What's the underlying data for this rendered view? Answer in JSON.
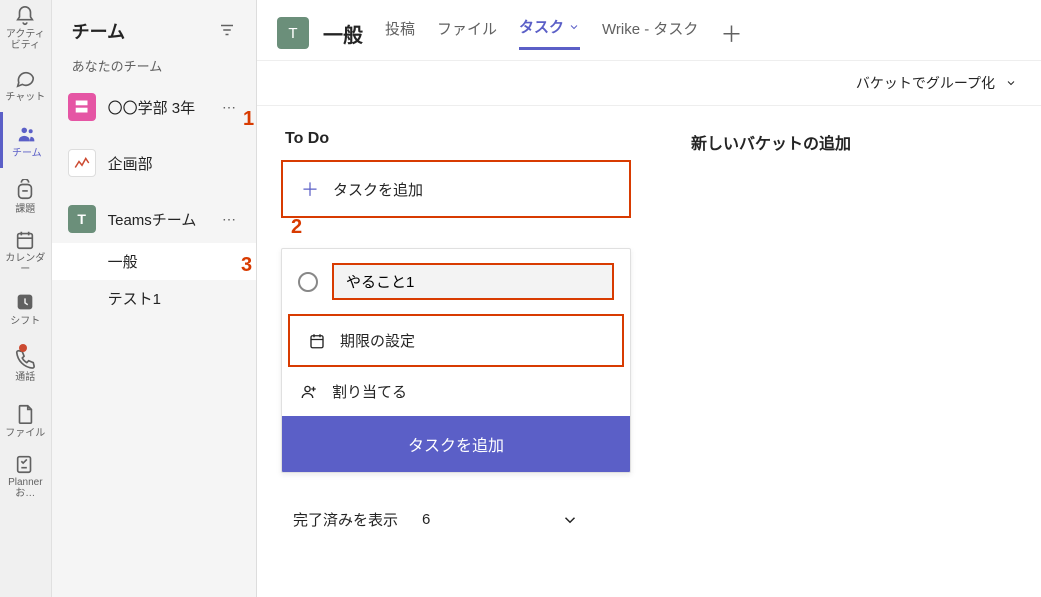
{
  "rail": {
    "activity": "アクティビティ",
    "chat": "チャット",
    "teams": "チーム",
    "assignments": "課題",
    "calendar": "カレンダー",
    "shifts": "シフト",
    "calls": "通話",
    "files": "ファイル",
    "planner": "Planner お…"
  },
  "sidebar": {
    "title": "チーム",
    "your_teams": "あなたのチーム",
    "teams": [
      {
        "name": "〇〇学部 3年",
        "avatar": "〓",
        "color": "pink"
      },
      {
        "name": "企画部",
        "avatar": "📈",
        "color": "chart"
      },
      {
        "name": "Teamsチーム",
        "avatar": "T",
        "color": "teal"
      }
    ],
    "channels": [
      {
        "name": "一般",
        "active": true
      },
      {
        "name": "テスト1",
        "active": false
      }
    ]
  },
  "header": {
    "avatar": "T",
    "channel": "一般",
    "tabs": [
      {
        "label": "投稿",
        "active": false
      },
      {
        "label": "ファイル",
        "active": false
      },
      {
        "label": "タスク",
        "active": true,
        "chevron": true
      },
      {
        "label": "Wrike - タスク",
        "active": false
      }
    ]
  },
  "toolbar": {
    "group_by": "バケットでグループ化"
  },
  "board": {
    "bucket_title": "To Do",
    "add_task": "タスクを追加",
    "task_value": "やること1",
    "due_date": "期限の設定",
    "assign": "割り当てる",
    "submit": "タスクを追加",
    "show_done": "完了済みを表示",
    "done_count": "6",
    "new_bucket": "新しいバケットの追加",
    "callouts": {
      "one": "1",
      "two": "2",
      "three": "3"
    }
  }
}
